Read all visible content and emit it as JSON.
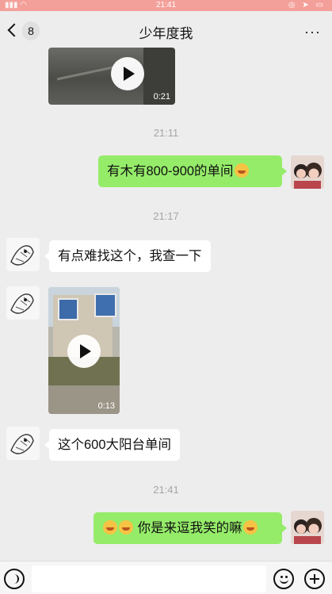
{
  "status_bar": {
    "carrier": "",
    "time": "21:41",
    "icons": "signal wifi location battery"
  },
  "nav": {
    "back_count": "8",
    "title": "少年度我",
    "more_label": "···"
  },
  "messages": [
    {
      "type": "video",
      "from": "other",
      "duration": "0:21"
    },
    {
      "type": "time",
      "text": "21:11"
    },
    {
      "type": "text",
      "from": "me",
      "text": "有木有800-900的单间"
    },
    {
      "type": "time",
      "text": "21:17"
    },
    {
      "type": "text",
      "from": "other",
      "text": "有点难找这个，我查一下"
    },
    {
      "type": "video",
      "from": "other",
      "duration": "0:13"
    },
    {
      "type": "text",
      "from": "other",
      "text": "这个600大阳台单间"
    },
    {
      "type": "time",
      "text": "21:41"
    },
    {
      "type": "text",
      "from": "me",
      "text": "你是来逗我笑的嘛"
    }
  ],
  "icons": {
    "back": "chevron-left-icon",
    "more": "more-dots-icon",
    "voice": "voice-icon",
    "emoji": "emoji-icon",
    "plus": "plus-icon",
    "emoji_reaction": "laughing-face-emoji"
  },
  "colors": {
    "self_bubble": "#95ec69",
    "other_bubble": "#ffffff",
    "background": "#ededed",
    "status_bar": "#f4a09a"
  }
}
